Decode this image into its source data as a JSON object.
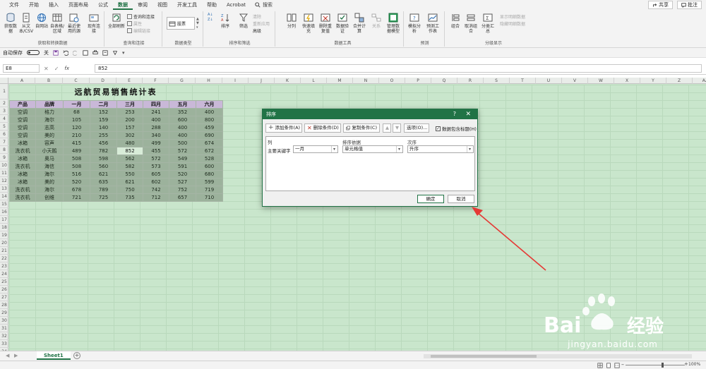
{
  "menu": {
    "items": [
      "文件",
      "开始",
      "插入",
      "页面布局",
      "公式",
      "数据",
      "审阅",
      "视图",
      "开发工具",
      "帮助",
      "Acrobat"
    ],
    "active_index": 5,
    "search_label": "搜索",
    "share_label": "共享",
    "comment_label": "批注"
  },
  "ribbon": {
    "get_data_group": {
      "label": "获取和转换数据",
      "buttons": [
        "获取数据",
        "从文本/CSV",
        "自网站",
        "自表格/区域",
        "最近使用的源",
        "现有连接"
      ]
    },
    "queries_group": {
      "label": "查询和连接",
      "refresh_label": "全部刷新",
      "items": [
        "查询和连接",
        "属性",
        "编辑链接"
      ]
    },
    "data_types_group": {
      "label": "数据类型",
      "stock_label": "股票"
    },
    "sort_filter_group": {
      "label": "排序和筛选",
      "sort_label": "排序",
      "filter_label": "筛选",
      "items": [
        "清除",
        "重新应用",
        "高级"
      ]
    },
    "data_tools_group": {
      "label": "数据工具",
      "buttons": [
        "分列",
        "快速填充",
        "删除重复值",
        "数据验证",
        "合并计算",
        "关系",
        "管理数据模型"
      ]
    },
    "forecast_group": {
      "label": "预测",
      "buttons": [
        "模拟分析",
        "预测工作表"
      ]
    },
    "outline_group": {
      "label": "分级显示",
      "buttons": [
        "组合",
        "取消组合",
        "分类汇总"
      ],
      "items": [
        "显示明细数据",
        "隐藏明细数据"
      ]
    }
  },
  "qat": {
    "autosave_label": "自动保存",
    "autosave_state": "关"
  },
  "formula_bar": {
    "name_box": "E8",
    "fx": "fx",
    "value": "852"
  },
  "columns": [
    "A",
    "B",
    "C",
    "D",
    "E",
    "F",
    "G",
    "H",
    "I",
    "J",
    "K",
    "L",
    "M",
    "N",
    "O",
    "P",
    "Q",
    "R",
    "S",
    "T",
    "U",
    "V",
    "W",
    "X",
    "Y",
    "Z",
    "AA"
  ],
  "rows": [
    "1",
    "2",
    "3",
    "4",
    "5",
    "6",
    "7",
    "8",
    "9",
    "10",
    "11",
    "12",
    "13",
    "14",
    "15",
    "16",
    "17",
    "18",
    "19",
    "20",
    "21",
    "22",
    "23",
    "24",
    "25",
    "26",
    "27",
    "28",
    "29",
    "30",
    "31",
    "32",
    "33",
    "34"
  ],
  "sheet_table": {
    "title": "远航贸易销售统计表",
    "headers": [
      "产品",
      "品牌",
      "一月",
      "二月",
      "三月",
      "四月",
      "五月",
      "六月"
    ],
    "rows": [
      [
        "空调",
        "格力",
        "68",
        "152",
        "253",
        "241",
        "352",
        "400"
      ],
      [
        "空调",
        "海尔",
        "105",
        "159",
        "200",
        "400",
        "600",
        "800"
      ],
      [
        "空调",
        "志高",
        "120",
        "140",
        "157",
        "288",
        "400",
        "459"
      ],
      [
        "空调",
        "美的",
        "210",
        "255",
        "302",
        "340",
        "400",
        "690"
      ],
      [
        "冰箱",
        "容声",
        "415",
        "456",
        "480",
        "499",
        "500",
        "674"
      ],
      [
        "洗衣机",
        "小天鹅",
        "489",
        "782",
        "852",
        "455",
        "572",
        "672"
      ],
      [
        "冰箱",
        "奥马",
        "508",
        "598",
        "562",
        "572",
        "549",
        "528"
      ],
      [
        "洗衣机",
        "海信",
        "508",
        "560",
        "582",
        "573",
        "591",
        "600"
      ],
      [
        "冰箱",
        "海尔",
        "516",
        "621",
        "550",
        "605",
        "520",
        "680"
      ],
      [
        "冰箱",
        "美的",
        "520",
        "635",
        "621",
        "602",
        "527",
        "599"
      ],
      [
        "洗衣机",
        "海尔",
        "678",
        "789",
        "750",
        "742",
        "752",
        "719"
      ],
      [
        "洗衣机",
        "创维",
        "721",
        "725",
        "735",
        "712",
        "657",
        "710"
      ]
    ]
  },
  "sheet_tabs": {
    "active": "Sheet1"
  },
  "status": {
    "zoom": "100%"
  },
  "dialog": {
    "title": "排序",
    "help": "?",
    "close": "✕",
    "add_level": "添加条件(A)",
    "delete_level": "删除条件(D)",
    "copy_level": "复制条件(C)",
    "options": "选项(O)...",
    "has_headers": "数据包含标题(H)",
    "col_header": "列",
    "sort_on_header": "排序依据",
    "order_header": "次序",
    "row_label": "主要关键字",
    "key_value": "一月",
    "sort_on_value": "单元格值",
    "order_value": "升序",
    "ok": "确定",
    "cancel": "取消"
  },
  "watermark": {
    "brand": "Bai",
    "brand_cn": "经验",
    "url": "jingyan.baidu.com"
  }
}
